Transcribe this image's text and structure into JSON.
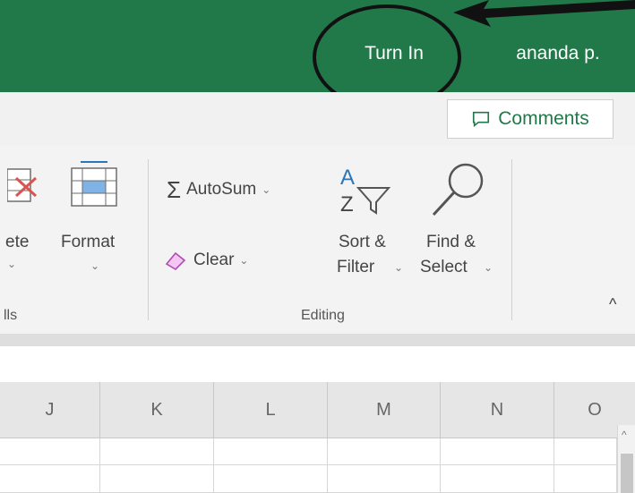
{
  "titlebar": {
    "turn_in": "Turn In",
    "user": "ananda p."
  },
  "comments": {
    "label": "Comments"
  },
  "ribbon": {
    "delete_partial": "ete",
    "format": "Format",
    "cells_partial": "lls",
    "autosum": "AutoSum",
    "clear": "Clear",
    "sort_l1": "Sort &",
    "sort_l2": "Filter",
    "find_l1": "Find &",
    "find_l2": "Select",
    "editing": "Editing"
  },
  "columns": [
    "J",
    "K",
    "L",
    "M",
    "N",
    "O"
  ],
  "colors": {
    "accent": "#21794a",
    "ribbon_bg": "#f3f3f3",
    "header_bg": "#e6e6e6"
  },
  "icons": [
    "delete-icon",
    "format-icon",
    "sigma-icon",
    "sort-filter-icon",
    "find-icon",
    "eraser-icon",
    "comment-icon",
    "collapse-ribbon-icon"
  ]
}
